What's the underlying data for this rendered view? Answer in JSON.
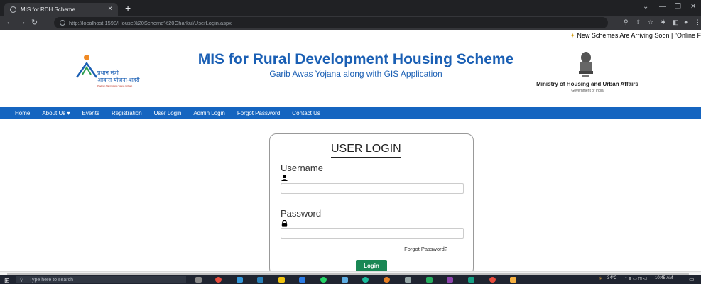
{
  "browser": {
    "tab_title": "MIS for RDH Scheme",
    "tab_close": "×",
    "new_tab": "+",
    "url_host": "http://localhost",
    "url_rest": ":1598/House%20Scheme%20Gharkul/UserLogin.aspx"
  },
  "marquee": "New Schemes Are Arriving Soon | \"Online F",
  "header": {
    "logo_hindi_line1": "प्रधान मंत्री",
    "logo_hindi_line2": "आवास योजना-शहरी",
    "logo_english": "Pradhan Mantri Awas Yojana (Urban)",
    "title": "MIS for Rural Development Housing Scheme",
    "subtitle": "Garib Awas Yojana along with GIS Application",
    "ministry": "Ministry of Housing and Urban Affairs",
    "ministry_sub": "Government of India"
  },
  "nav": {
    "items": [
      "Home",
      "About Us ▾",
      "Events",
      "Registration",
      "User Login",
      "Admin Login",
      "Forgot Password",
      "Contact Us"
    ]
  },
  "login": {
    "title": "USER LOGIN",
    "username_label": "Username",
    "username_value": "",
    "password_label": "Password",
    "password_value": "",
    "forgot_link": "Forgot Password?",
    "login_button": "Login"
  },
  "taskbar": {
    "search_placeholder": "Type here to search",
    "weather": "34°C",
    "time": "10:45 AM"
  },
  "colors": {
    "title_blue": "#1a5fb4",
    "nav_blue": "#1565c0",
    "login_green": "#198754"
  }
}
